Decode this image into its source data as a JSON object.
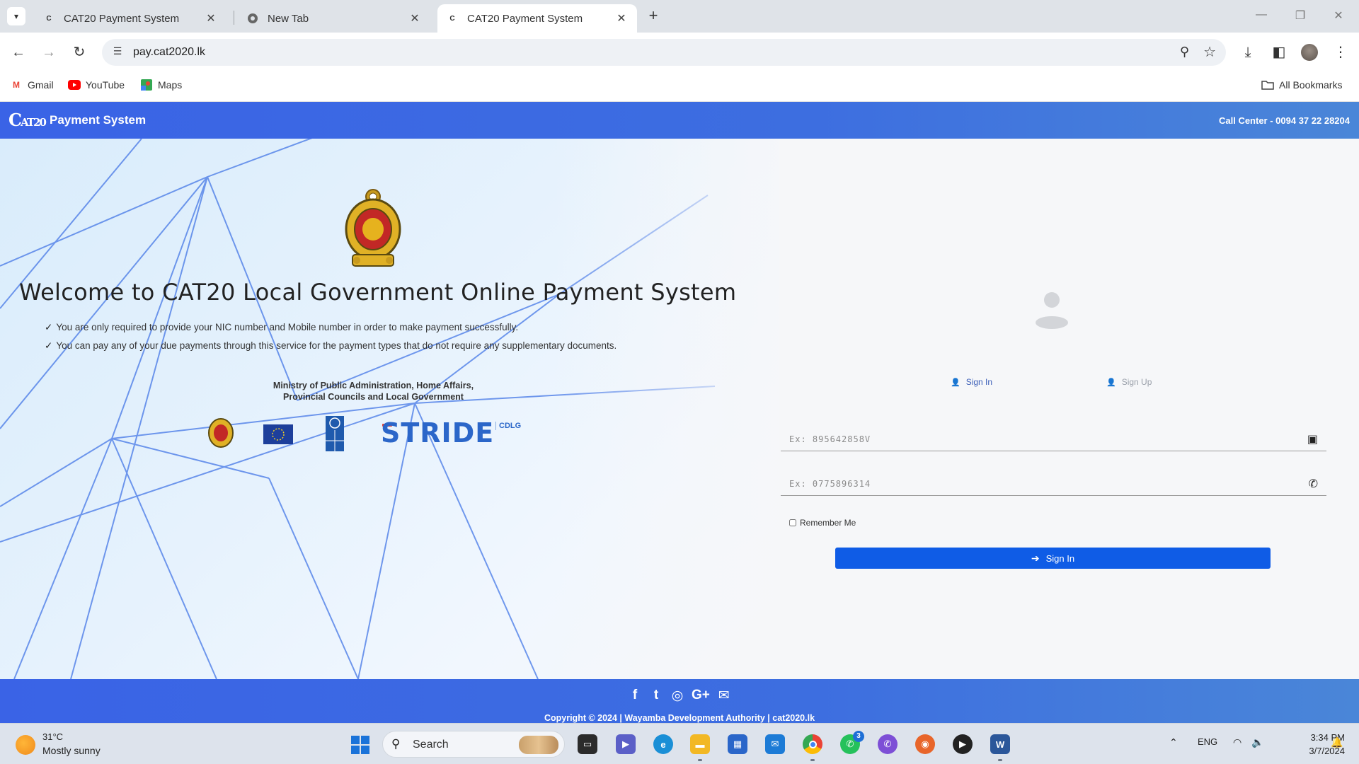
{
  "browser": {
    "tabs": [
      {
        "title": "CAT20 Payment System",
        "favicon": "cat20-logo-icon",
        "active": false
      },
      {
        "title": "New Tab",
        "favicon": "chrome-icon",
        "active": false
      },
      {
        "title": "CAT20 Payment System",
        "favicon": "cat20-logo-icon",
        "active": true
      }
    ],
    "tab_close": "✕",
    "new_tab": "+",
    "url": "pay.cat2020.lk",
    "bookmarks": [
      {
        "label": "Gmail",
        "icon": "gmail-icon",
        "color": "#ea4335"
      },
      {
        "label": "YouTube",
        "icon": "youtube-icon",
        "color": "#ff0000"
      },
      {
        "label": "Maps",
        "icon": "maps-icon",
        "color": "#34a853"
      }
    ],
    "all_bookmarks": "All Bookmarks"
  },
  "site": {
    "logo_text": "CAT20",
    "brand": "Payment System",
    "call_center": "Call Center - 0094 37 22 28204",
    "welcome": "Welcome to CAT20 Local Government Online Payment System",
    "bullets": [
      "You are only required to provide your NIC number and Mobile number in order to make payment successfully.",
      "You can pay any of your due payments through this service for the payment types that do not require any supplementary documents."
    ],
    "ministry_line1": "Ministry of Public Administration, Home Affairs,",
    "ministry_line2": "Provincial Councils and Local Government",
    "partners": {
      "stride": "STRIDE",
      "cdlg": "CDLG"
    },
    "auth_tabs": {
      "signin": "Sign In",
      "signup": "Sign Up"
    },
    "nic_placeholder": "Ex: 895642858V",
    "mobile_placeholder": "Ex: 0775896314",
    "remember_me": "Remember Me",
    "signin_button": "Sign In",
    "social": [
      "f",
      "t",
      "◎",
      "G+",
      "✉"
    ],
    "copyright": "Copyright © 2024 | Wayamba Development Authority | cat2020.lk",
    "accent_color": "#3a63e6",
    "button_color": "#0f5ce6"
  },
  "taskbar": {
    "weather_temp": "31°C",
    "weather_desc": "Mostly sunny",
    "search_label": "Search",
    "whatsapp_badge": "3",
    "language": "ENG",
    "time": "3:34 PM",
    "date": "3/7/2024"
  }
}
